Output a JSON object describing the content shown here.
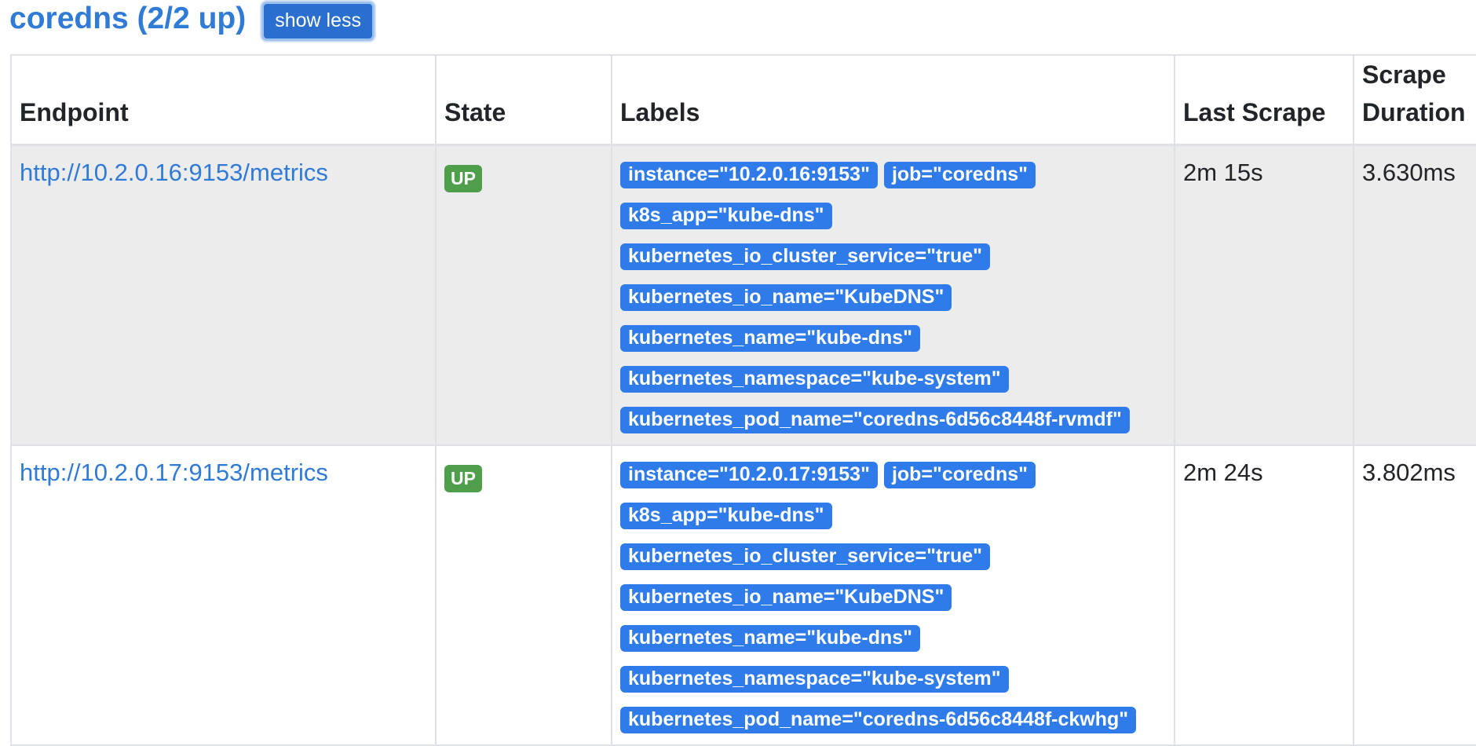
{
  "job": {
    "title": "coredns (2/2 up)",
    "toggle_label": "show less"
  },
  "columns": [
    "Endpoint",
    "State",
    "Labels",
    "Last Scrape",
    "Scrape Duration"
  ],
  "columns_wrapped": {
    "scrape_duration_line1": "Scrape",
    "scrape_duration_line2": "Duration"
  },
  "rows": [
    {
      "endpoint": "http://10.2.0.16:9153/metrics",
      "state": "UP",
      "labels": [
        "instance=\"10.2.0.16:9153\"",
        "job=\"coredns\"",
        "k8s_app=\"kube-dns\"",
        "kubernetes_io_cluster_service=\"true\"",
        "kubernetes_io_name=\"KubeDNS\"",
        "kubernetes_name=\"kube-dns\"",
        "kubernetes_namespace=\"kube-system\"",
        "kubernetes_pod_name=\"coredns-6d56c8448f-rvmdf\""
      ],
      "last_scrape": "2m 15s",
      "scrape_duration": "3.630ms"
    },
    {
      "endpoint": "http://10.2.0.17:9153/metrics",
      "state": "UP",
      "labels": [
        "instance=\"10.2.0.17:9153\"",
        "job=\"coredns\"",
        "k8s_app=\"kube-dns\"",
        "kubernetes_io_cluster_service=\"true\"",
        "kubernetes_io_name=\"KubeDNS\"",
        "kubernetes_name=\"kube-dns\"",
        "kubernetes_namespace=\"kube-system\"",
        "kubernetes_pod_name=\"coredns-6d56c8448f-ckwhg\""
      ],
      "last_scrape": "2m 24s",
      "scrape_duration": "3.802ms"
    }
  ],
  "colors": {
    "link": "#2f7bd6",
    "label_bg": "#2f7bea",
    "up_badge": "#4f9e4c",
    "row_shade": "#ececec"
  }
}
